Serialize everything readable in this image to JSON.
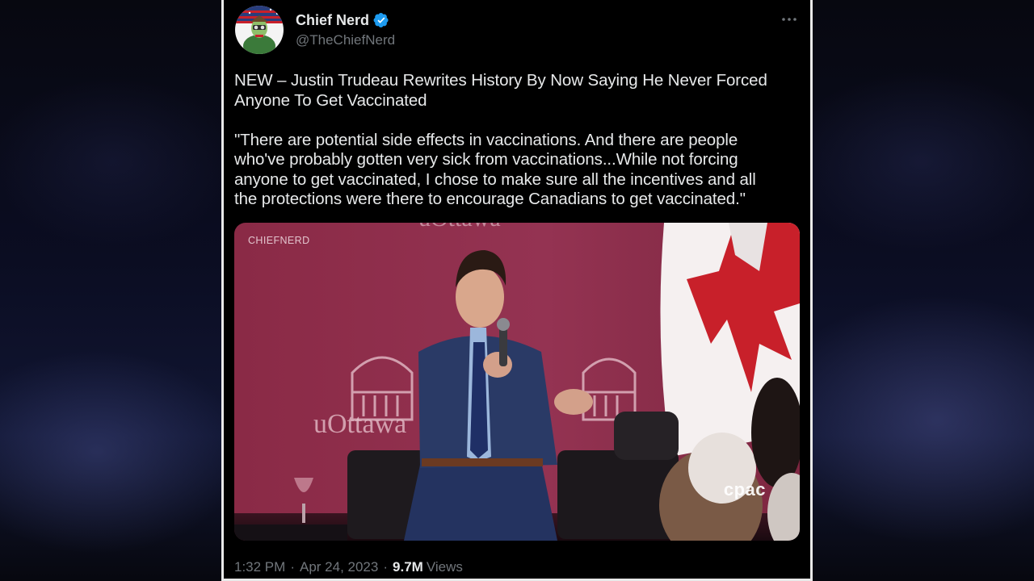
{
  "tweet": {
    "display_name": "Chief Nerd",
    "handle": "@TheChiefNerd",
    "text": "NEW – Justin Trudeau Rewrites History By Now Saying He Never Forced\nAnyone To Get Vaccinated\n\n\"There are potential side effects in vaccinations. And there are people\nwho've  probably gotten very sick from vaccinations...While not forcing\nanyone to get vaccinated, I chose to make sure all the incentives and all\nthe protections were there to encourage Canadians to get vaccinated.\"",
    "media": {
      "watermark_left": "CHIEFNERD",
      "watermark_right": "cpac",
      "backdrop_text": "uOttawa",
      "backdrop_text_top": "uOttawa",
      "colors": {
        "backdrop": "#8e2e4a",
        "suit": "#2a3a66",
        "flag_red": "#c8202a"
      }
    },
    "time": "1:32 PM",
    "date": "Apr 24, 2023",
    "separator": "·",
    "views_count": "9.7M",
    "views_label": "Views"
  },
  "icons": {
    "verified": "verified-badge-icon",
    "more": "more-options-icon"
  },
  "colors": {
    "background": "#000000",
    "text_primary": "#e7e9ea",
    "text_secondary": "#71767b",
    "verified_blue": "#1d9bf0",
    "frame_border": "#e9e9e9"
  }
}
